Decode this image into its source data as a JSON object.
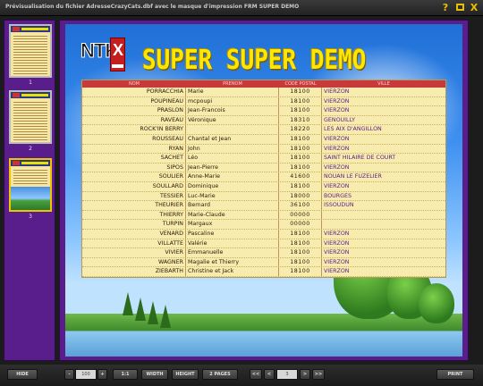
{
  "window": {
    "title": "Prévisualisation du fichier AdresseCrazyCats.dbf avec le masque d'impression FRM SUPER DEMO",
    "buttons": {
      "help": "?",
      "minimize": "_",
      "close": "X"
    }
  },
  "thumbnails": [
    {
      "number": "1"
    },
    {
      "number": "2"
    },
    {
      "number": "3"
    }
  ],
  "page": {
    "logo_text": "NTK",
    "logo_letter": "X",
    "title": "SUPER SUPER DEMO",
    "table": {
      "headers": [
        "NOM",
        "PRENOM",
        "CODE POSTAL",
        "VILLE"
      ],
      "rows": [
        [
          "PORRACCHIA",
          "Marie",
          "18100",
          "VIERZON"
        ],
        [
          "POUPINEAU",
          "mcpoupi",
          "18100",
          "VIERZON"
        ],
        [
          "PRASLON",
          "Jean-Francois",
          "18100",
          "VIERZON"
        ],
        [
          "RAVEAU",
          "Véronique",
          "18310",
          "GENOUILLY"
        ],
        [
          "ROCK'IN BERRY",
          "",
          "18220",
          "LES AIX D'ANGILLON"
        ],
        [
          "ROUSSEAU",
          "Chantal et Jean",
          "18100",
          "VIERZON"
        ],
        [
          "RYAN",
          "John",
          "18100",
          "VIERZON"
        ],
        [
          "SACHET",
          "Léo",
          "18100",
          "SAINT HILAIRE DE COURT"
        ],
        [
          "SIPOS",
          "Jean-Pierre",
          "18100",
          "VIERZON"
        ],
        [
          "SOULIER",
          "Anne-Marie",
          "41600",
          "NOUAN LE FUZELIER"
        ],
        [
          "SOULLARD",
          "Dominique",
          "18100",
          "VIERZON"
        ],
        [
          "TESSIER",
          "Luc-Marie",
          "18000",
          "BOURGES"
        ],
        [
          "THEURIER",
          "Bernard",
          "36100",
          "ISSOUDUN"
        ],
        [
          "THIERRY",
          "Marie-Claude",
          "00000",
          ""
        ],
        [
          "TURPIN",
          "Margaux",
          "00000",
          ""
        ],
        [
          "VENARD",
          "Pascaline",
          "18100",
          "VIERZON"
        ],
        [
          "VILLATTE",
          "Valérie",
          "18100",
          "VIERZON"
        ],
        [
          "VIVIER",
          "Emmanuelle",
          "18100",
          "VIERZON"
        ],
        [
          "WAGNER",
          "Magalie et Thierry",
          "18100",
          "VIERZON"
        ],
        [
          "ZIEBARTH",
          "Christine et Jack",
          "18100",
          "VIERZON"
        ]
      ]
    }
  },
  "toolbar": {
    "hide": "HIDE",
    "zoom_out": "-",
    "zoom_value": "100",
    "zoom_in": "+",
    "one_to_one": "1:1",
    "width": "WIDTH",
    "height": "HEIGHT",
    "two_pages": "2 PAGES",
    "first": "<<",
    "prev": "<",
    "page_value": "3",
    "next": ">",
    "last": ">>",
    "print": "PRINT"
  },
  "colors": {
    "accent_yellow": "#f0c400",
    "panel_purple": "#5a1e8c",
    "table_bg": "#f7ecad",
    "header_red": "#c83a3a",
    "city_text": "#5a1a8a"
  }
}
